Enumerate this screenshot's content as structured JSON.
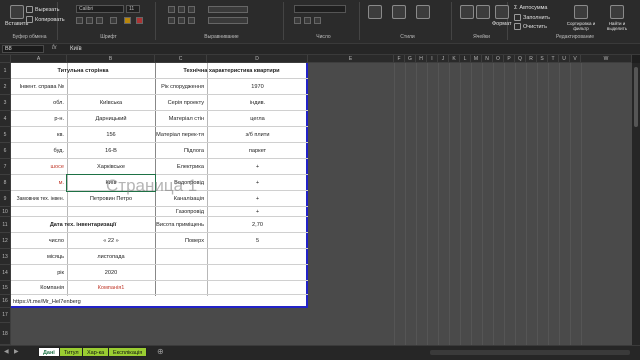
{
  "ribbon": {
    "paste_label": "Вставить",
    "cut_label": "Вырезать",
    "copy_label": "Копировать",
    "clipboard_group": "Буфер обмена",
    "font_name": "Calibri",
    "font_size": "11",
    "font_group": "Шрифт",
    "align_group": "Выравнивание",
    "number_group": "Число",
    "styles_group": "Стили",
    "cells_group": "Ячейки",
    "format_label": "Формат",
    "autosum_label": "Автосумма",
    "fill_label": "Заполнить",
    "clear_label": "Очистить",
    "sort_label": "Сортировка и фильтр",
    "find_label": "Найти и выделить",
    "edit_group": "Редактирование"
  },
  "formula_bar": {
    "name_box": "B8",
    "fx": "fx",
    "value": "Київ"
  },
  "columns": [
    "A",
    "B",
    "C",
    "D",
    "E",
    "F",
    "G",
    "H",
    "I",
    "J",
    "K",
    "L",
    "M",
    "N",
    "O",
    "P",
    "Q",
    "R",
    "S",
    "T",
    "U",
    "V",
    "W"
  ],
  "rows": [
    "1",
    "2",
    "3",
    "4",
    "5",
    "6",
    "7",
    "8",
    "9",
    "10",
    "11",
    "12",
    "13",
    "14",
    "15",
    "16",
    "17",
    "18"
  ],
  "sheet": {
    "title_left": "Титульна сторінка",
    "title_right": "Технічна характеристика квартири",
    "left_rows": [
      {
        "label": "Інвент. справа №",
        "value": ""
      },
      {
        "label": "обл.",
        "value": "Київська"
      },
      {
        "label": "р-н.",
        "value": "Дарницький"
      },
      {
        "label": "кв.",
        "value": "156"
      },
      {
        "label": "буд.",
        "value": "16-В"
      },
      {
        "label": "шосе",
        "value": "Харківське"
      },
      {
        "label": "м.",
        "value": "Київ"
      },
      {
        "label": "Замовник тех. інвен.",
        "value": "Петровин Петро"
      }
    ],
    "right_rows": [
      {
        "label": "Рік спорудження",
        "value": "1970"
      },
      {
        "label": "Серія проекту",
        "value": "індив."
      },
      {
        "label": "Матеріал стін",
        "value": "цегла"
      },
      {
        "label": "Матеріал перек-тя",
        "value": "з/б плити"
      },
      {
        "label": "Підлога",
        "value": "паркет"
      },
      {
        "label": "Електрика",
        "value": "+"
      },
      {
        "label": "Водопровід",
        "value": "+"
      },
      {
        "label": "Каналізація",
        "value": "+"
      },
      {
        "label": "Газопровід",
        "value": "+"
      },
      {
        "label": "Висота приміщень",
        "value": "2,70"
      },
      {
        "label": "Поверх",
        "value": "5"
      }
    ],
    "date_title": "Дата тех. інвентаризації",
    "date_rows": [
      {
        "label": "число",
        "value": "« 22 »"
      },
      {
        "label": "місяць",
        "value": "листопада"
      },
      {
        "label": "рік",
        "value": "2020"
      },
      {
        "label": "Компанія",
        "value": "Компанія1"
      }
    ],
    "footer_link": "https://t.me/Mr_Hel7enberg",
    "page_watermark": "Страница 1"
  },
  "tabs": [
    "Дані",
    "Титул",
    "Хар-ка",
    "Експлікація"
  ],
  "colors": {
    "sheet_border": "#2323c8",
    "tab_active": "#ffffff",
    "tab_green": "#9acd32",
    "red_text": "#c0392b"
  }
}
